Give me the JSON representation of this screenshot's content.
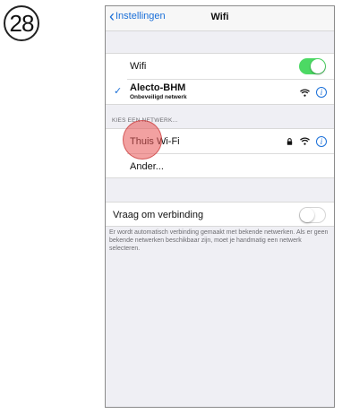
{
  "step": {
    "number": "28"
  },
  "nav": {
    "back_label": "Instellingen",
    "title": "Wifi"
  },
  "wifi": {
    "label": "Wifi",
    "enabled": true
  },
  "connected_network": {
    "name": "Alecto-BHM",
    "subtitle": "Onbeveiligd netwerk"
  },
  "choose_network": {
    "header": "KIES EEN NETWERK...",
    "networks": [
      {
        "name": "Thuis Wi-Fi"
      }
    ],
    "other_label": "Ander..."
  },
  "ask_to_join": {
    "label": "Vraag om verbinding",
    "enabled": false,
    "description": "Er wordt automatisch verbinding gemaakt met bekende netwerken. Als er geen bekende netwerken beschikbaar zijn, moet je handmatig een netwerk selecteren."
  },
  "colors": {
    "accent": "#1a6fd8",
    "toggle_on": "#4cd964",
    "tap_highlight": "#e85454"
  },
  "icons": {
    "lock": "lock-icon",
    "wifi": "wifi-signal-icon",
    "info": "info-icon",
    "check": "checkmark-icon",
    "back": "chevron-left-icon"
  }
}
